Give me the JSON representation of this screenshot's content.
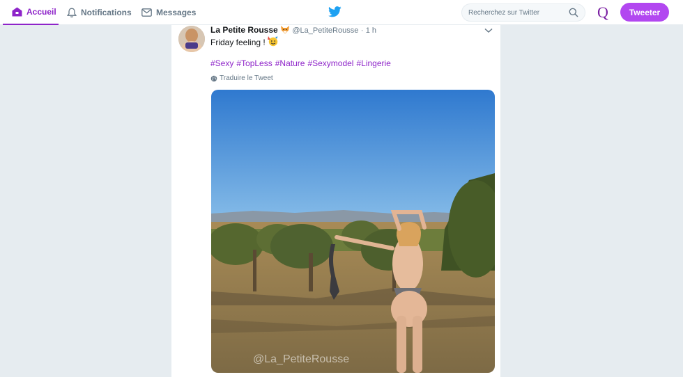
{
  "nav": {
    "home_label": "Accueil",
    "notifications_label": "Notifications",
    "messages_label": "Messages"
  },
  "search": {
    "placeholder": "Recherchez sur Twitter"
  },
  "account": {
    "avatar_letter": "Q"
  },
  "actions": {
    "tweet_label": "Tweeter"
  },
  "tweet": {
    "name": "La Petite Rousse",
    "handle": "@La_PetiteRousse",
    "separator": "·",
    "time": "1 h",
    "text": "Friday feeling !",
    "hashtags": [
      "#Sexy",
      "#TopLess",
      "#Nature",
      "#Sexymodel",
      "#Lingerie"
    ],
    "translate_label": "Traduire le Tweet",
    "media_watermark": "@La_PetiteRousse"
  },
  "colors": {
    "accent": "#8e24c9",
    "tweet_button": "#b247f0",
    "page_background": "#e6ecf0",
    "secondary_text": "#657786",
    "twitter_blue": "#1da1f2"
  },
  "icons": {
    "home": "home-icon",
    "notifications": "bell-icon",
    "messages": "envelope-icon",
    "logo": "twitter-bird-icon",
    "search": "search-icon",
    "caret": "chevron-down-icon",
    "globe": "globe-icon",
    "name_emoji": "fox-emoji",
    "text_emoji": "party-emoji"
  }
}
